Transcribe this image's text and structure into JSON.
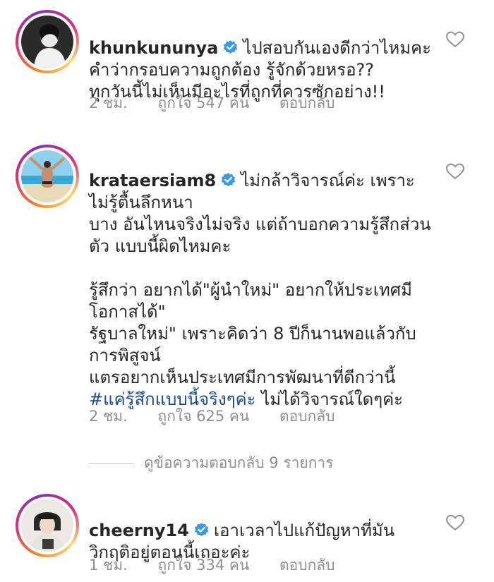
{
  "comments": [
    {
      "username": "khunkununya",
      "text": "ไปสอบกันเองดีกว่าไหมคะ คำว่ากรอบความถูกต้อง รู้จักด้วยหรอ??\nทุกวันนี้ไม่เห็นมีอะไรที่ถูกที่ควรซักอย่าง!!",
      "hashtag": "",
      "after_hashtag": "",
      "time": "2 ชม.",
      "likes": "ถูกใจ 547 คน",
      "reply": "ตอบกลับ"
    },
    {
      "username": "krataersiam8",
      "text": "ไม่กล้าวิจารณ์ค่ะ เพราะไม่รู้ตื้นลึกหนา\nบาง อันไหนจริงไม่จริง แต่ถ้าบอกความรู้สึกส่วนตัว แบบนี้ผิดไหมคะ\n\nรู้สึกว่า อยากได้\"ผู้นำใหม่\" อยากให้ประเทศมีโอกาสได้\"\nรัฐบาลใหม่\" เพราะคิดว่า 8 ปีก็นานพอแล้วกับการพิสูจน์\nแตรอยากเห็นประเทศมีการพัฒนาที่ดีกว่านี้\n",
      "hashtag": "#แค่รู้สึกแบบนี้จริงๆค่ะ",
      "after_hashtag": " ไม่ได้วิจารณ์ใดๆค่ะ",
      "time": "2 ชม.",
      "likes": "ถูกใจ 625 คน",
      "reply": "ตอบกลับ"
    },
    {
      "username": "cheerny14",
      "text": "เอาเวลาไปแก้ปัญหาที่มันวิกฤติอยู่ตอนนี้เถอะค่ะ",
      "hashtag": "",
      "after_hashtag": "",
      "time": "1 ชม.",
      "likes": "ถูกใจ 334 คน",
      "reply": "ตอบกลับ"
    }
  ],
  "view_replies": "ดูข้อความตอบกลับ 9 รายการ",
  "colors": {
    "verified": "#3897f0",
    "hashtag": "#1a4a8a",
    "muted": "#8e8e8e"
  }
}
